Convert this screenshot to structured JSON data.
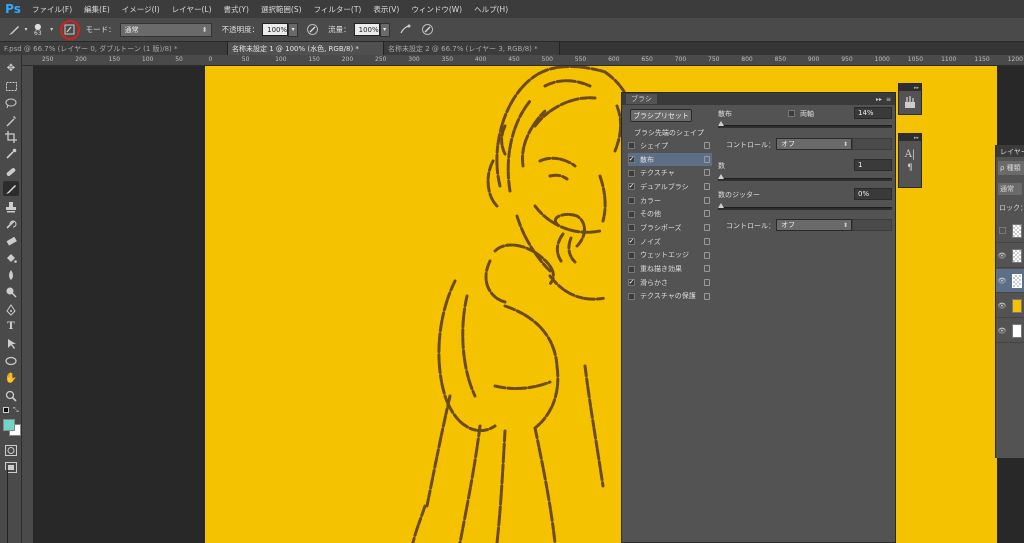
{
  "app": {
    "logo": "Ps"
  },
  "menu": [
    "ファイル(F)",
    "編集(E)",
    "イメージ(I)",
    "レイヤー(L)",
    "書式(Y)",
    "選択範囲(S)",
    "フィルター(T)",
    "表示(V)",
    "ウィンドウ(W)",
    "ヘルプ(H)"
  ],
  "options": {
    "brush_size": "63",
    "mode_label": "モード：",
    "mode_value": "通常",
    "opacity_label": "不透明度：",
    "opacity_value": "100%",
    "flow_label": "流量：",
    "flow_value": "100%"
  },
  "tabs": [
    "F.psd @ 66.7% (レイヤー 0, ダブルトーン (1 版)/8) *",
    "名称未設定 1 @ 100% (水色, RGB/8) *",
    "名称未設定 2 @ 66.7% (レイヤー 3, RGB/8) *"
  ],
  "ruler_ticks": [
    "250",
    "200",
    "150",
    "100",
    "50",
    "0",
    "50",
    "100",
    "150",
    "200",
    "250",
    "300",
    "350",
    "400",
    "450",
    "500",
    "550",
    "600",
    "650",
    "700",
    "750",
    "800",
    "850",
    "900",
    "950",
    "1000",
    "1050",
    "1100",
    "1150",
    "1200"
  ],
  "brush_panel": {
    "title": "ブラシ",
    "preset_button": "ブラシプリセット",
    "shape_header": "ブラシ先端のシェイプ",
    "items": [
      {
        "label": "シェイプ",
        "checked": false,
        "selected": false
      },
      {
        "label": "散布",
        "checked": true,
        "selected": true
      },
      {
        "label": "テクスチャ",
        "checked": false,
        "selected": false
      },
      {
        "label": "デュアルブラシ",
        "checked": true,
        "selected": false
      },
      {
        "label": "カラー",
        "checked": false,
        "selected": false
      },
      {
        "label": "その他",
        "checked": false,
        "selected": false
      },
      {
        "label": "ブラシポーズ",
        "checked": false,
        "selected": false
      },
      {
        "label": "ノイズ",
        "checked": true,
        "selected": false
      },
      {
        "label": "ウェットエッジ",
        "checked": false,
        "selected": false
      },
      {
        "label": "重ね描き効果",
        "checked": false,
        "selected": false
      },
      {
        "label": "滑らかさ",
        "checked": true,
        "selected": false
      },
      {
        "label": "テクスチャの保護",
        "checked": false,
        "selected": false
      }
    ],
    "scatter_label": "散布",
    "both_axes_label": "両軸",
    "scatter_value": "14%",
    "control_label": "コントロール：",
    "control_value": "オフ",
    "count_label": "数",
    "count_value": "1",
    "count_jitter_label": "数のジッター",
    "count_jitter_value": "0%",
    "control2_label": "コントロール：",
    "control2_value": "オフ"
  },
  "layers_panel": {
    "title": "レイヤー",
    "filter": "ρ 種類",
    "blend": "通常",
    "lock": "ロック："
  },
  "colors": {
    "canvas": "#f5c200",
    "line_art": "#6b4a18",
    "foreground": "#6fd6c6",
    "selected_row": "#5d6f87",
    "highlight_circle": "#d42020"
  }
}
